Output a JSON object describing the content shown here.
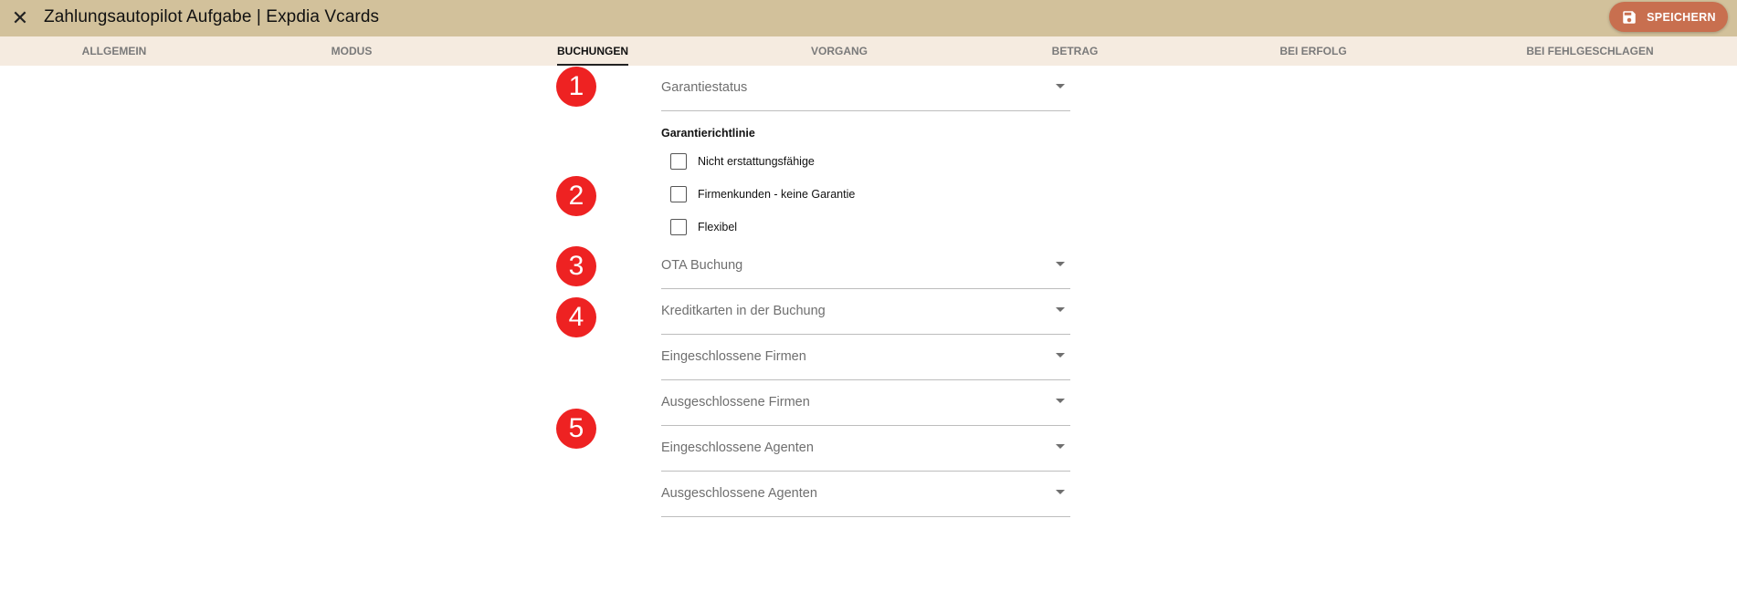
{
  "window": {
    "title": "Zahlungsautopilot Aufgabe | Expdia Vcards",
    "close_icon": "close-icon"
  },
  "toolbar": {
    "save_label": "SPEICHERN",
    "save_icon": "floppy-disk-icon",
    "save_color": "#c86f4f"
  },
  "colors": {
    "header_bg": "#d2c19b",
    "tabbar_bg": "#f5ebe0",
    "marker": "#ee2222"
  },
  "tabs": [
    {
      "label": "ALLGEMEIN",
      "active": false
    },
    {
      "label": "MODUS",
      "active": false
    },
    {
      "label": "BUCHUNGEN",
      "active": true
    },
    {
      "label": "VORGANG",
      "active": false
    },
    {
      "label": "BETRAG",
      "active": false
    },
    {
      "label": "BEI ERFOLG",
      "active": false
    },
    {
      "label": "BEI FEHLGESCHLAGEN",
      "active": false
    }
  ],
  "markers": [
    "1",
    "2",
    "3",
    "4",
    "5"
  ],
  "form": {
    "garantiestatus": {
      "label": "Garantiestatus"
    },
    "garantierichtlinie": {
      "title": "Garantierichtlinie",
      "options": [
        {
          "label": "Nicht erstattungsfähige",
          "checked": false
        },
        {
          "label": "Firmenkunden - keine Garantie",
          "checked": false
        },
        {
          "label": "Flexibel",
          "checked": false
        }
      ]
    },
    "ota_buchung": {
      "label": "OTA Buchung"
    },
    "kreditkarten": {
      "label": "Kreditkarten in der Buchung"
    },
    "eingeschlossene_firmen": {
      "label": "Eingeschlossene Firmen"
    },
    "ausgeschlossene_firmen": {
      "label": "Ausgeschlossene Firmen"
    },
    "eingeschlossene_agenten": {
      "label": "Eingeschlossene Agenten"
    },
    "ausgeschlossene_agenten": {
      "label": "Ausgeschlossene Agenten"
    }
  }
}
